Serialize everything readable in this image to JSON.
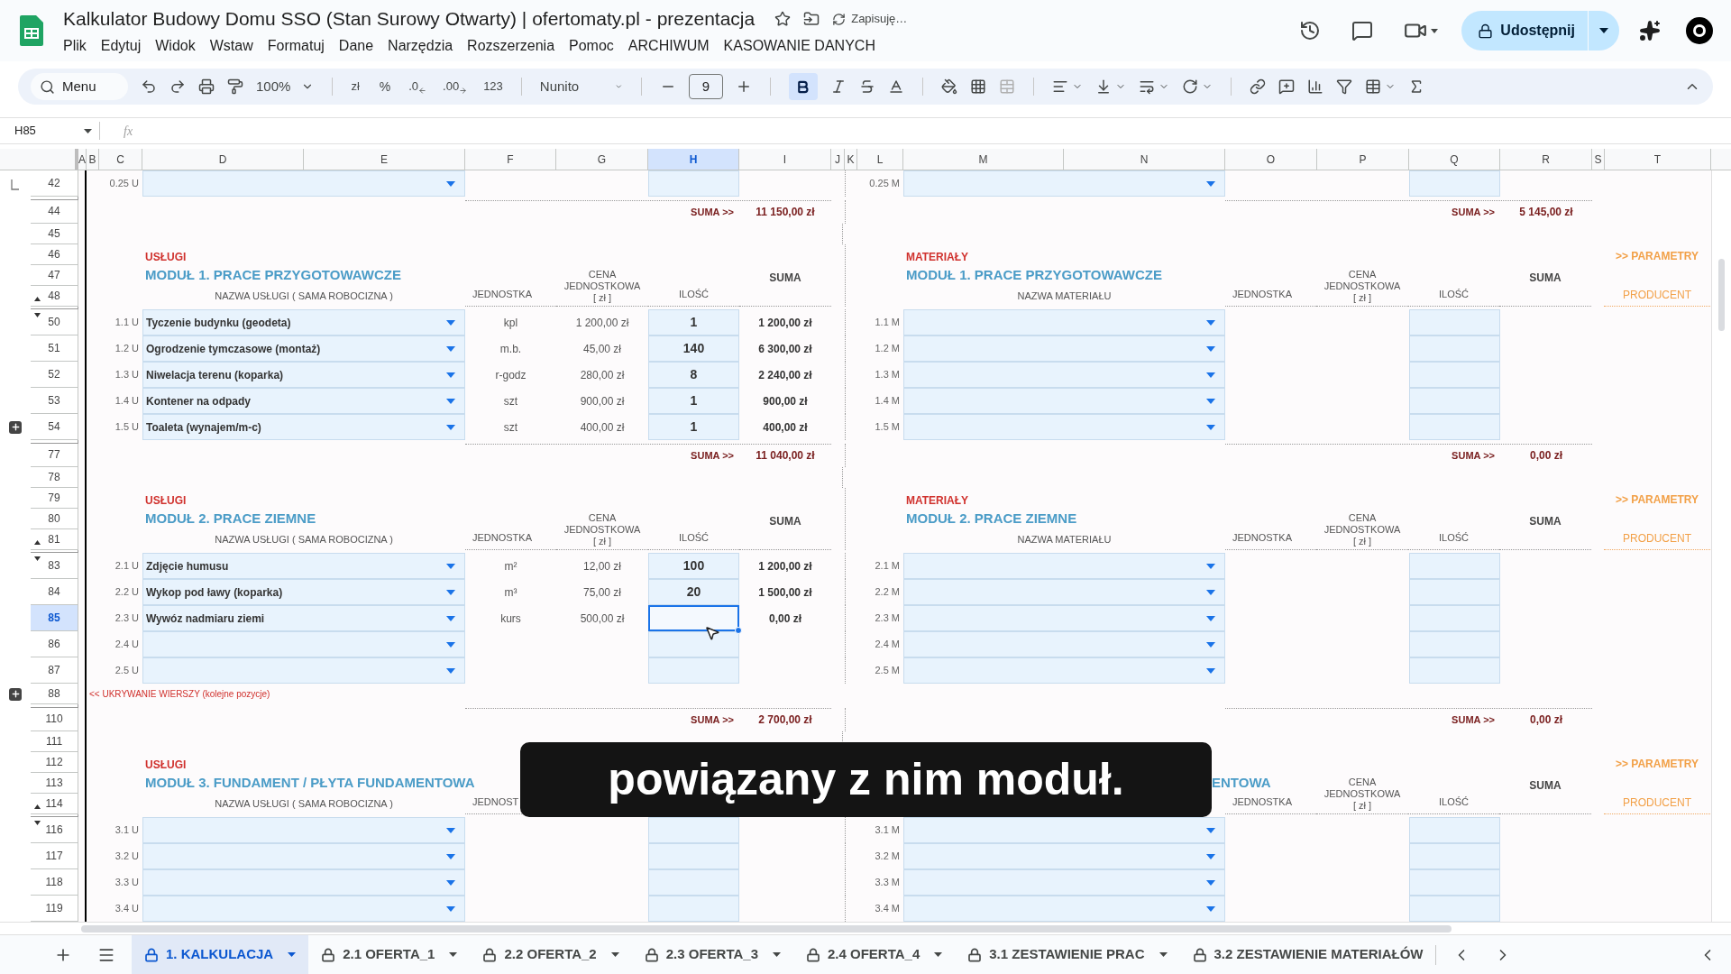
{
  "title": "Kalkulator Budowy Domu SSO (Stan Surowy Otwarty) | ofertomaty.pl - prezentacja",
  "save_status": "Zapisuję…",
  "menu": [
    "Plik",
    "Edytuj",
    "Widok",
    "Wstaw",
    "Formatuj",
    "Dane",
    "Narzędzia",
    "Rozszerzenia",
    "Pomoc",
    "ARCHIWUM",
    "KASOWANIE DANYCH"
  ],
  "share_button": "Udostępnij",
  "toolbar": {
    "search": "Menu",
    "zoom": "100%",
    "currency": "zł",
    "percent": "%",
    "decrease_decimals": ".0",
    "increase_decimals": ".00",
    "number_format": "123",
    "font": "Nunito",
    "font_size": "9",
    "bold": true
  },
  "name_box": "H85",
  "formula_label": "fx",
  "columns": [
    {
      "label": "A",
      "selected": false
    },
    {
      "label": "B",
      "selected": false
    },
    {
      "label": "C",
      "selected": false
    },
    {
      "label": "D",
      "selected": false
    },
    {
      "label": "E",
      "selected": false
    },
    {
      "label": "F",
      "selected": false
    },
    {
      "label": "G",
      "selected": false
    },
    {
      "label": "H",
      "selected": true
    },
    {
      "label": "I",
      "selected": false
    },
    {
      "label": "J",
      "selected": false
    },
    {
      "label": "K",
      "selected": false
    },
    {
      "label": "L",
      "selected": false
    },
    {
      "label": "M",
      "selected": false
    },
    {
      "label": "N",
      "selected": false
    },
    {
      "label": "O",
      "selected": false
    },
    {
      "label": "P",
      "selected": false
    },
    {
      "label": "Q",
      "selected": false
    },
    {
      "label": "R",
      "selected": false
    },
    {
      "label": "S",
      "selected": false
    },
    {
      "label": "T",
      "selected": false
    }
  ],
  "rows": [
    {
      "kind": "item",
      "hidden_after": true,
      "numbers": [
        {
          "number": "42",
          "selected": false,
          "kind": "bracket"
        }
      ],
      "left": {
        "code": "0.25 U",
        "qty_selected": false
      },
      "right": {
        "code": "0.25 M"
      }
    },
    {
      "kind": "sum",
      "hidden_after": false,
      "numbers": [
        {
          "number": "44",
          "selected": false,
          "kind": "plain"
        }
      ],
      "left": {
        "label": "SUMA >>",
        "value": "11 150,00 zł"
      },
      "right": {
        "label": "SUMA >>",
        "value": "5 145,00 zł"
      }
    },
    {
      "kind": "blank",
      "hidden_after": false,
      "numbers": [
        {
          "number": "45",
          "selected": false,
          "kind": "plain"
        }
      ]
    },
    {
      "kind": "header",
      "hidden_after": true,
      "numbers": [
        {
          "number": "46",
          "selected": false,
          "kind": "plain"
        },
        {
          "number": "47",
          "selected": false,
          "kind": "plain"
        },
        {
          "number": "48",
          "selected": false,
          "kind": "up"
        }
      ],
      "left": {
        "section": "USŁUGI",
        "title": "MODUŁ 1. PRACE PRZYGOTOWAWCZE",
        "title_cut": false,
        "name_heading": "NAZWA USŁUGI ( SAMA ROBOCIZNA )",
        "unit_heading": "JEDNOSTKA",
        "price_heading": [
          "CENA",
          "JEDNOSTKOWA",
          "[ zł ]"
        ],
        "qty_heading": "ILOŚĆ",
        "sum_heading": "SUMA"
      },
      "right": {
        "section": "MATERIAŁY",
        "title": "MODUŁ 1. PRACE PRZYGOTOWAWCZE",
        "title_cut": false,
        "name_heading": "NAZWA MATERIAŁU",
        "unit_heading": "JEDNOSTKA",
        "price_heading": [
          "CENA",
          "JEDNOSTKOWA",
          "[ zł ]"
        ],
        "qty_heading": "ILOŚĆ",
        "sum_heading": "SUMA",
        "link": ">> PARAMETRY",
        "producer_heading": "PRODUCENT"
      }
    },
    {
      "kind": "item",
      "hidden_after": false,
      "numbers": [
        {
          "number": "50",
          "selected": false,
          "kind": "down"
        }
      ],
      "left": {
        "code": "1.1 U",
        "name": "Tyczenie budynku (geodeta)",
        "unit": "kpl",
        "price": "1 200,00 zł",
        "qty": "1",
        "sum": "1 200,00 zł",
        "qty_selected": false
      },
      "right": {
        "code": "1.1 M"
      }
    },
    {
      "kind": "item",
      "hidden_after": false,
      "numbers": [
        {
          "number": "51",
          "selected": false,
          "kind": "plain"
        }
      ],
      "left": {
        "code": "1.2 U",
        "name": "Ogrodzenie tymczasowe (montaż)",
        "unit": "m.b.",
        "price": "45,00 zł",
        "qty": "140",
        "sum": "6 300,00 zł",
        "qty_selected": false
      },
      "right": {
        "code": "1.2 M"
      }
    },
    {
      "kind": "item",
      "hidden_after": false,
      "numbers": [
        {
          "number": "52",
          "selected": false,
          "kind": "plain"
        }
      ],
      "left": {
        "code": "1.3 U",
        "name": "Niwelacja terenu (koparka)",
        "unit": "r-godz",
        "price": "280,00 zł",
        "qty": "8",
        "sum": "2 240,00 zł",
        "qty_selected": false
      },
      "right": {
        "code": "1.3 M"
      }
    },
    {
      "kind": "item",
      "hidden_after": false,
      "numbers": [
        {
          "number": "53",
          "selected": false,
          "kind": "plain"
        }
      ],
      "left": {
        "code": "1.4 U",
        "name": "Kontener na odpady",
        "unit": "szt",
        "price": "900,00 zł",
        "qty": "1",
        "sum": "900,00 zł",
        "qty_selected": false
      },
      "right": {
        "code": "1.4 M"
      }
    },
    {
      "kind": "item",
      "hidden_after": true,
      "numbers": [
        {
          "number": "54",
          "selected": false,
          "kind": "expand"
        }
      ],
      "left": {
        "code": "1.5 U",
        "name": "Toaleta (wynajem/m-c)",
        "unit": "szt",
        "price": "400,00 zł",
        "qty": "1",
        "sum": "400,00 zł",
        "qty_selected": false
      },
      "right": {
        "code": "1.5 M"
      }
    },
    {
      "kind": "sum",
      "hidden_after": false,
      "numbers": [
        {
          "number": "77",
          "selected": false,
          "kind": "plain"
        }
      ],
      "left": {
        "label": "SUMA >>",
        "value": "11 040,00 zł"
      },
      "right": {
        "label": "SUMA >>",
        "value": "0,00 zł"
      }
    },
    {
      "kind": "blank",
      "hidden_after": false,
      "numbers": [
        {
          "number": "78",
          "selected": false,
          "kind": "plain"
        }
      ]
    },
    {
      "kind": "header",
      "hidden_after": true,
      "numbers": [
        {
          "number": "79",
          "selected": false,
          "kind": "plain"
        },
        {
          "number": "80",
          "selected": false,
          "kind": "plain"
        },
        {
          "number": "81",
          "selected": false,
          "kind": "up"
        }
      ],
      "left": {
        "section": "USŁUGI",
        "title": "MODUŁ 2. PRACE ZIEMNE",
        "title_cut": false,
        "name_heading": "NAZWA USŁUGI ( SAMA ROBOCIZNA )",
        "unit_heading": "JEDNOSTKA",
        "price_heading": [
          "CENA",
          "JEDNOSTKOWA",
          "[ zł ]"
        ],
        "qty_heading": "ILOŚĆ",
        "sum_heading": "SUMA"
      },
      "right": {
        "section": "MATERIAŁY",
        "title": "MODUŁ 2. PRACE ZIEMNE",
        "title_cut": false,
        "name_heading": "NAZWA MATERIAŁU",
        "unit_heading": "JEDNOSTKA",
        "price_heading": [
          "CENA",
          "JEDNOSTKOWA",
          "[ zł ]"
        ],
        "qty_heading": "ILOŚĆ",
        "sum_heading": "SUMA",
        "link": ">> PARAMETRY",
        "producer_heading": "PRODUCENT"
      }
    },
    {
      "kind": "item",
      "hidden_after": false,
      "numbers": [
        {
          "number": "83",
          "selected": false,
          "kind": "down"
        }
      ],
      "left": {
        "code": "2.1 U",
        "name": "Zdjęcie humusu",
        "unit": "m²",
        "price": "12,00 zł",
        "qty": "100",
        "sum": "1 200,00 zł",
        "qty_selected": false
      },
      "right": {
        "code": "2.1 M"
      }
    },
    {
      "kind": "item",
      "hidden_after": false,
      "numbers": [
        {
          "number": "84",
          "selected": false,
          "kind": "plain"
        }
      ],
      "left": {
        "code": "2.2 U",
        "name": "Wykop pod ławy (koparka)",
        "unit": "m³",
        "price": "75,00 zł",
        "qty": "20",
        "sum": "1 500,00 zł",
        "qty_selected": false
      },
      "right": {
        "code": "2.2 M"
      }
    },
    {
      "kind": "item",
      "hidden_after": false,
      "numbers": [
        {
          "number": "85",
          "selected": true,
          "kind": "plain"
        }
      ],
      "left": {
        "code": "2.3 U",
        "name": "Wywóz nadmiaru ziemi",
        "unit": "kurs",
        "price": "500,00 zł",
        "sum": "0,00 zł",
        "qty_selected": true
      },
      "right": {
        "code": "2.3 M"
      }
    },
    {
      "kind": "item",
      "hidden_after": false,
      "numbers": [
        {
          "number": "86",
          "selected": false,
          "kind": "plain"
        }
      ],
      "left": {
        "code": "2.4 U",
        "qty_selected": false
      },
      "right": {
        "code": "2.4 M"
      }
    },
    {
      "kind": "item",
      "hidden_after": false,
      "numbers": [
        {
          "number": "87",
          "selected": false,
          "kind": "plain"
        }
      ],
      "left": {
        "code": "2.5 U",
        "qty_selected": false
      },
      "right": {
        "code": "2.5 M"
      }
    },
    {
      "kind": "note",
      "hidden_after": true,
      "numbers": [
        {
          "number": "88",
          "selected": false,
          "kind": "expand"
        }
      ],
      "text": "<< UKRYWANIE WIERSZY (kolejne pozycje)"
    },
    {
      "kind": "sum",
      "hidden_after": false,
      "numbers": [
        {
          "number": "110",
          "selected": false,
          "kind": "plain"
        }
      ],
      "left": {
        "label": "SUMA >>",
        "value": "2 700,00 zł"
      },
      "right": {
        "label": "SUMA >>",
        "value": "0,00 zł"
      }
    },
    {
      "kind": "blank",
      "hidden_after": false,
      "numbers": [
        {
          "number": "111",
          "selected": false,
          "kind": "plain"
        }
      ]
    },
    {
      "kind": "header",
      "hidden_after": true,
      "numbers": [
        {
          "number": "112",
          "selected": false,
          "kind": "plain"
        },
        {
          "number": "113",
          "selected": false,
          "kind": "plain"
        },
        {
          "number": "114",
          "selected": false,
          "kind": "up"
        }
      ],
      "left": {
        "section": "USŁUGI",
        "title": "MODUŁ 3. FUNDAMENT / PŁYTA FUNDAMENTOWA",
        "title_cut": false,
        "name_heading": "NAZWA USŁUGI ( SAMA ROBOCIZNA )",
        "unit_heading": "JEDNOST"
      },
      "right": {
        "title": "ENTOWA",
        "title_cut": true,
        "unit_heading": "JEDNOSTKA",
        "price_heading": [
          "CENA",
          "JEDNOSTKOWA",
          "[ zł ]"
        ],
        "qty_heading": "ILOŚĆ",
        "sum_heading": "SUMA",
        "link": ">> PARAMETRY",
        "producer_heading": "PRODUCENT"
      }
    },
    {
      "kind": "item",
      "hidden_after": false,
      "numbers": [
        {
          "number": "116",
          "selected": false,
          "kind": "down"
        }
      ],
      "left": {
        "code": "3.1 U",
        "qty_selected": false
      },
      "right": {
        "code": "3.1 M"
      }
    },
    {
      "kind": "item",
      "hidden_after": false,
      "numbers": [
        {
          "number": "117",
          "selected": false,
          "kind": "plain"
        }
      ],
      "left": {
        "code": "3.2 U",
        "qty_selected": false
      },
      "right": {
        "code": "3.2 M"
      }
    },
    {
      "kind": "item",
      "hidden_after": false,
      "numbers": [
        {
          "number": "118",
          "selected": false,
          "kind": "plain"
        }
      ],
      "left": {
        "code": "3.3 U",
        "qty_selected": false
      },
      "right": {
        "code": "3.3 M"
      }
    },
    {
      "kind": "item",
      "hidden_after": false,
      "numbers": [
        {
          "number": "119",
          "selected": false,
          "kind": "plain"
        }
      ],
      "left": {
        "code": "3.4 U",
        "qty_selected": false
      },
      "right": {
        "code": "3.4 M"
      }
    }
  ],
  "caption": "powiązany z nim moduł.",
  "sheet_tabs": [
    {
      "label": "1. KALKULACJA",
      "selected": true
    },
    {
      "label": "2.1 OFERTA_1",
      "selected": false
    },
    {
      "label": "2.2 OFERTA_2",
      "selected": false
    },
    {
      "label": "2.3 OFERTA_3",
      "selected": false
    },
    {
      "label": "2.4 OFERTA_4",
      "selected": false
    },
    {
      "label": "3.1 ZESTAWIENIE PRAC",
      "selected": false
    },
    {
      "label": "3.2 ZESTAWIENIE MATERIAŁÓW",
      "selected": false
    }
  ]
}
